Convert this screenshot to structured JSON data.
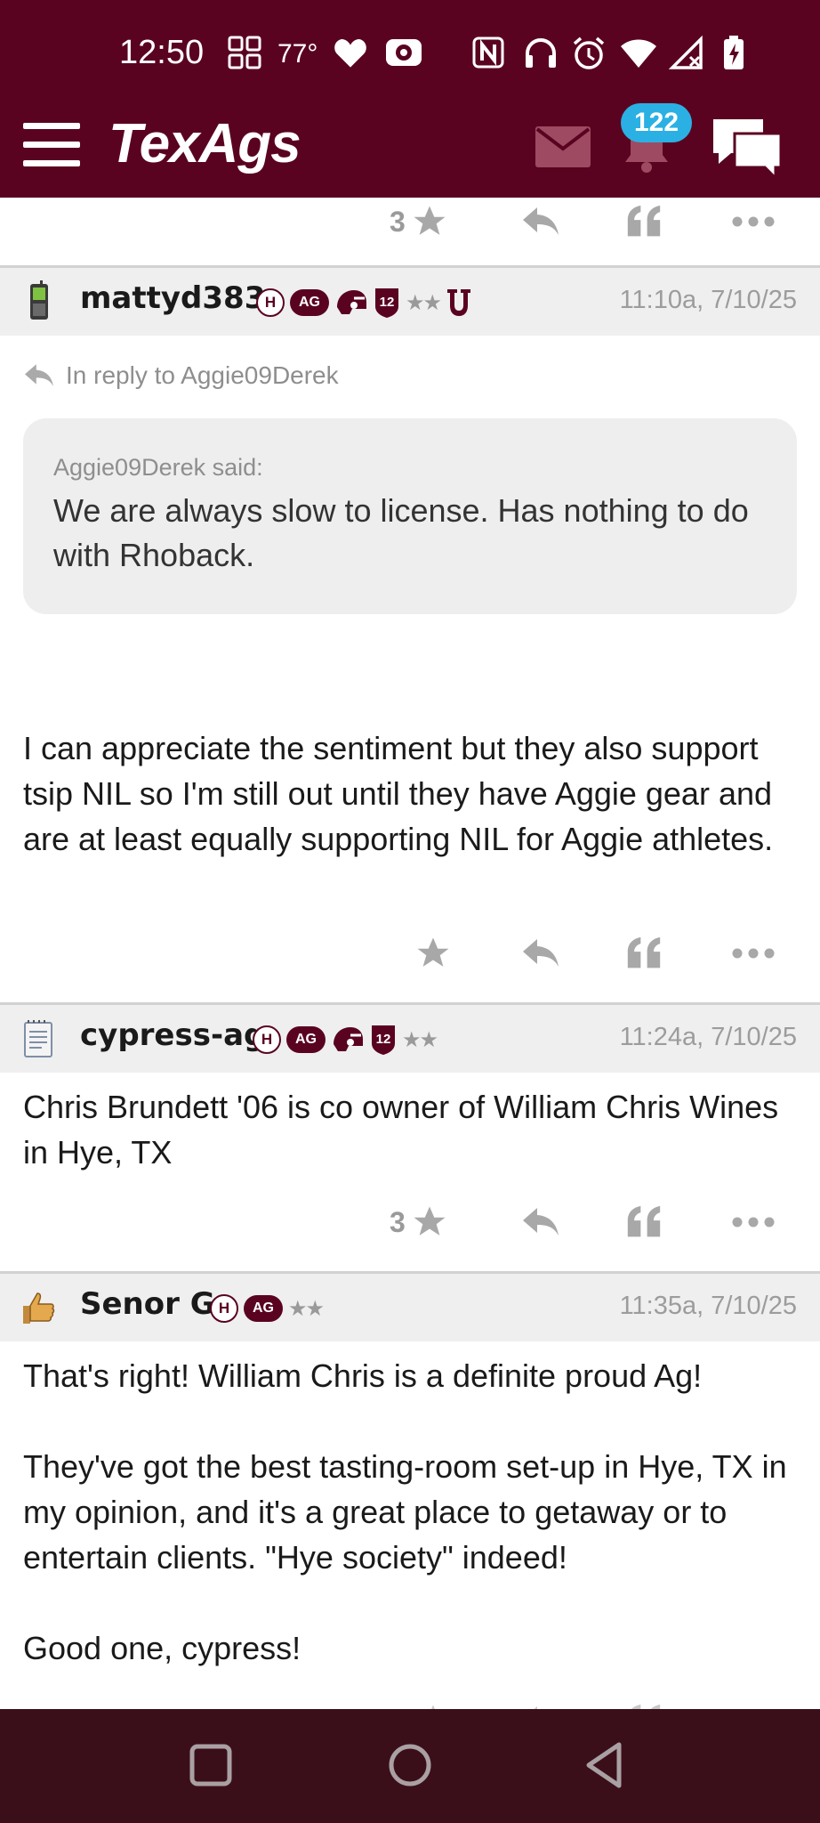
{
  "status_bar": {
    "time": "12:50",
    "temperature": "77°"
  },
  "app_bar": {
    "logo": "TexAgs",
    "notification_count": "122",
    "icons": [
      "menu-icon",
      "mail-icon",
      "bell-icon",
      "chat-icon"
    ]
  },
  "colors": {
    "brand": "#5a0321",
    "badge_blue": "#2bb0e3"
  },
  "top_actions": {
    "star_count": "3"
  },
  "posts": [
    {
      "username": "mattyd383",
      "timestamp": "11:10a, 7/10/25",
      "badges": [
        "H",
        "AG"
      ],
      "stars": "★★",
      "reply_to": "In reply to Aggie09Derek",
      "quote_author": "Aggie09Derek said:",
      "quote_text": "We are always slow to license. Has nothing to do with Rhoback.",
      "body": "I can appreciate the sentiment but they also support tsip NIL so I'm still out until they have Aggie gear and are at least equally supporting NIL for Aggie athletes.",
      "star_count": ""
    },
    {
      "username": "cypress-ag",
      "timestamp": "11:24a, 7/10/25",
      "badges": [
        "H",
        "AG"
      ],
      "stars": "★★",
      "body": "Chris Brundett '06 is co owner of William Chris Wines in Hye, TX",
      "star_count": "3"
    },
    {
      "username": "Senor G",
      "timestamp": "11:35a, 7/10/25",
      "badges": [
        "H",
        "AG"
      ],
      "stars": "★★",
      "body_lines": [
        "That's right! William Chris is a definite proud Ag!",
        "They've got the best tasting-room set-up in Hye, TX in my opinion, and it's a great place to getaway or to entertain clients. \"Hye society\" indeed!",
        "Good one, cypress!"
      ]
    }
  ]
}
